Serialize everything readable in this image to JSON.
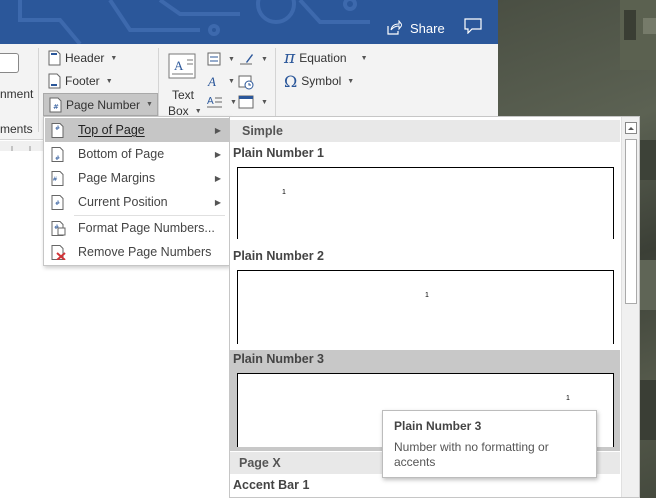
{
  "titlebar": {
    "share_label": "Share",
    "share_icon": "share-icon",
    "comment_icon": "comment-icon",
    "accent_color": "#2b579a"
  },
  "ribbon": {
    "left_partial_1": "nment",
    "left_partial_2": "ments",
    "header_label": "Header",
    "footer_label": "Footer",
    "page_number_label": "Page Number",
    "textbox_label_1": "Text",
    "textbox_label_2": "Box",
    "equation_label": "Equation",
    "symbol_label": "Symbol"
  },
  "menu": {
    "items": [
      {
        "label": "Top of Page",
        "active": true,
        "submenu": true
      },
      {
        "label": "Bottom of Page",
        "submenu": true
      },
      {
        "label": "Page Margins",
        "submenu": true
      },
      {
        "label": "Current Position",
        "submenu": true
      },
      {
        "label": "Format Page Numbers..."
      },
      {
        "label": "Remove Page Numbers"
      }
    ]
  },
  "gallery": {
    "section_simple": "Simple",
    "section_pagex": "Page X",
    "items": [
      {
        "label": "Plain Number 1",
        "sample": "1"
      },
      {
        "label": "Plain Number 2",
        "sample": "1"
      },
      {
        "label": "Plain Number 3",
        "sample": "1"
      },
      {
        "label": "Accent Bar 1"
      }
    ]
  },
  "tooltip": {
    "title": "Plain Number 3",
    "body": "Number with no formatting or accents"
  }
}
